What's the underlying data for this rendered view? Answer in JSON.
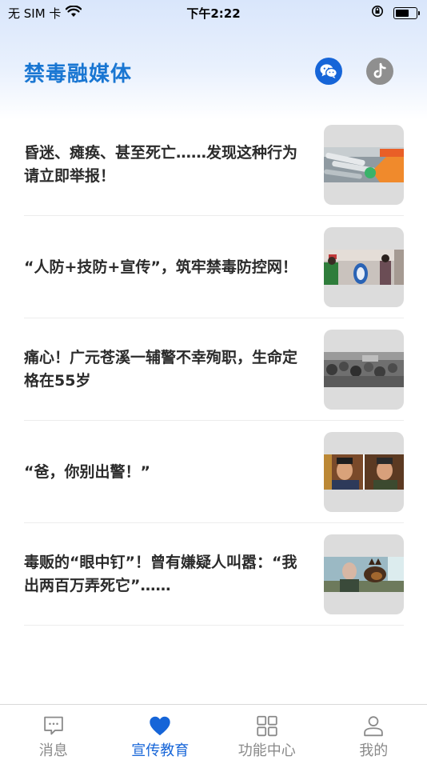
{
  "status_bar": {
    "carrier": "无 SIM 卡",
    "time": "下午2:22"
  },
  "header": {
    "title": "禁毒融媒体",
    "buttons": [
      {
        "icon": "wechat-icon",
        "color": "#1665d8"
      },
      {
        "icon": "tiktok-icon",
        "color": "#8f8f8f"
      }
    ]
  },
  "news": [
    {
      "title": "昏迷、瘫痪、甚至死亡……发现这种行为请立即举报！",
      "thumb": "syringes"
    },
    {
      "title": "“人防+技防+宣传”，筑牢禁毒防控网！",
      "thumb": "checkpoint"
    },
    {
      "title": "痛心！广元苍溪一辅警不幸殉职，生命定格在55岁",
      "thumb": "crowd"
    },
    {
      "title": "“爸，你别出警！”",
      "thumb": "police"
    },
    {
      "title": "毒贩的“眼中钉”！曾有嫌疑人叫嚣：“我出两百万弄死它”……",
      "thumb": "police-dog"
    }
  ],
  "tabs": [
    {
      "label": "消息",
      "icon": "message-icon",
      "active": false
    },
    {
      "label": "宣传教育",
      "icon": "heart-icon",
      "active": true
    },
    {
      "label": "功能中心",
      "icon": "grid-icon",
      "active": false
    },
    {
      "label": "我的",
      "icon": "person-icon",
      "active": false
    }
  ],
  "colors": {
    "accent": "#1976d2",
    "tab_active": "#1665d8",
    "tab_inactive": "#8a8a8a"
  }
}
